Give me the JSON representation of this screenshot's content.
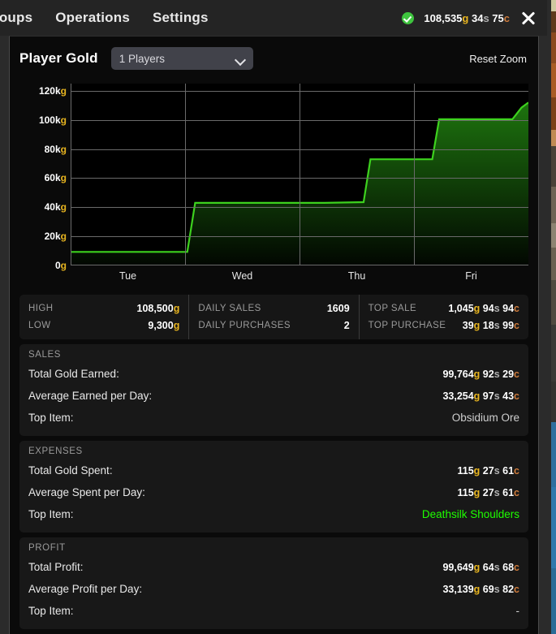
{
  "menubar": {
    "items": [
      {
        "label": "roups",
        "name": "menu-groups"
      },
      {
        "label": "Operations",
        "name": "menu-operations"
      },
      {
        "label": "Settings",
        "name": "menu-settings"
      }
    ],
    "status_icon": "check-circle-icon",
    "gold": {
      "gold": "108,535",
      "silver": "34",
      "copper": "75"
    },
    "close_icon": "close-icon"
  },
  "panel": {
    "title": "Player Gold",
    "player_select": {
      "value": "1 Players",
      "icon": "chevron-down-icon"
    },
    "reset_zoom": "Reset Zoom"
  },
  "chart_data": {
    "type": "area",
    "title": "Player Gold",
    "xlabel": "",
    "ylabel": "",
    "ytick_labels": [
      "120kg",
      "100kg",
      "80kg",
      "60kg",
      "40kg",
      "20kg",
      "0g"
    ],
    "ytick_values": [
      120000,
      100000,
      80000,
      60000,
      40000,
      20000,
      0
    ],
    "ylim": [
      0,
      125000
    ],
    "xtick_labels": [
      "Tue",
      "Wed",
      "Thu",
      "Fri"
    ],
    "grid": true,
    "legend": "none",
    "line_color": "#3dd11e",
    "fill_color": "#1f7a0f",
    "series": [
      {
        "name": "Player Gold",
        "points": [
          {
            "x": 0.0,
            "y": 9300
          },
          {
            "x": 0.255,
            "y": 9300
          },
          {
            "x": 0.272,
            "y": 43000
          },
          {
            "x": 0.555,
            "y": 43000
          },
          {
            "x": 0.64,
            "y": 43500
          },
          {
            "x": 0.655,
            "y": 73000
          },
          {
            "x": 0.79,
            "y": 73000
          },
          {
            "x": 0.805,
            "y": 100500
          },
          {
            "x": 0.965,
            "y": 100500
          },
          {
            "x": 0.985,
            "y": 108500
          },
          {
            "x": 1.0,
            "y": 112000
          }
        ]
      }
    ]
  },
  "stats": [
    {
      "name": "stat-col-high-low",
      "rows": [
        {
          "key": "HIGH",
          "gold": "108,500",
          "silver": "",
          "copper": ""
        },
        {
          "key": "LOW",
          "gold": "9,300",
          "silver": "",
          "copper": ""
        }
      ]
    },
    {
      "name": "stat-col-daily",
      "rows": [
        {
          "key": "DAILY SALES",
          "plain": "1609"
        },
        {
          "key": "DAILY PURCHASES",
          "plain": "2"
        }
      ]
    },
    {
      "name": "stat-col-top",
      "rows": [
        {
          "key": "TOP SALE",
          "gold": "1,045",
          "silver": "94",
          "copper": "94"
        },
        {
          "key": "TOP PURCHASE",
          "gold": "39",
          "silver": "18",
          "copper": "99"
        }
      ]
    }
  ],
  "sections": [
    {
      "name": "section-sales",
      "title": "SALES",
      "rows": [
        {
          "label": "Total Gold Earned:",
          "gold": "99,764",
          "silver": "92",
          "copper": "29"
        },
        {
          "label": "Average Earned per Day:",
          "gold": "33,254",
          "silver": "97",
          "copper": "43"
        },
        {
          "label": "Top Item:",
          "text": "Obsidium Ore",
          "style": "dim"
        }
      ]
    },
    {
      "name": "section-expenses",
      "title": "EXPENSES",
      "rows": [
        {
          "label": "Total Gold Spent:",
          "gold": "115",
          "silver": "27",
          "copper": "61"
        },
        {
          "label": "Average Spent per Day:",
          "gold": "115",
          "silver": "27",
          "copper": "61"
        },
        {
          "label": "Top Item:",
          "text": "Deathsilk Shoulders",
          "style": "green"
        }
      ]
    },
    {
      "name": "section-profit",
      "title": "PROFIT",
      "rows": [
        {
          "label": "Total Profit:",
          "gold": "99,649",
          "silver": "64",
          "copper": "68"
        },
        {
          "label": "Average Profit per Day:",
          "gold": "33,139",
          "silver": "69",
          "copper": "82"
        },
        {
          "label": "Top Item:",
          "text": "-",
          "style": "dim"
        }
      ]
    }
  ],
  "colors": {
    "gold": "#e8b520",
    "silver": "#b0b0b0",
    "copper": "#cf7c3c",
    "chart_line": "#3dd11e",
    "status_ok": "#3ec43e",
    "item_uncommon": "#1eff00"
  }
}
